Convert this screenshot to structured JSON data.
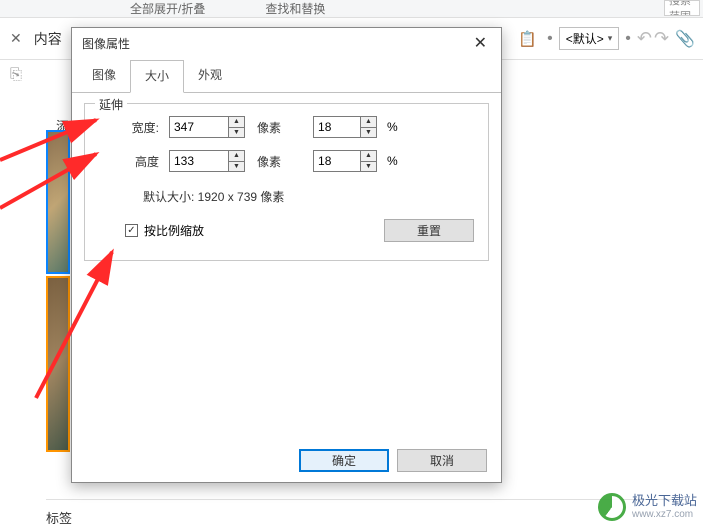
{
  "bg": {
    "toolbar_items": [
      "全部展开/折叠",
      "查找和替换"
    ],
    "search_placeholder": "搜索范围",
    "content_tab": "内容",
    "add_label": "添加",
    "default_select": "<默认>",
    "bottom_tag_label": "标签"
  },
  "dialog": {
    "title": "图像属性",
    "tabs": {
      "image": "图像",
      "size": "大小",
      "appearance": "外观"
    },
    "fieldset_legend": "延伸",
    "width_label": "宽度:",
    "height_label": "高度",
    "width_px": "347",
    "height_px": "133",
    "width_pct": "18",
    "height_pct": "18",
    "unit_px": "像素",
    "unit_pct": "%",
    "default_size": "默认大小: 1920 x 739 像素",
    "scale_proportionally": "按比例缩放",
    "reset": "重置",
    "ok": "确定",
    "cancel": "取消"
  },
  "watermark": {
    "name": "极光下载站",
    "url": "www.xz7.com"
  }
}
